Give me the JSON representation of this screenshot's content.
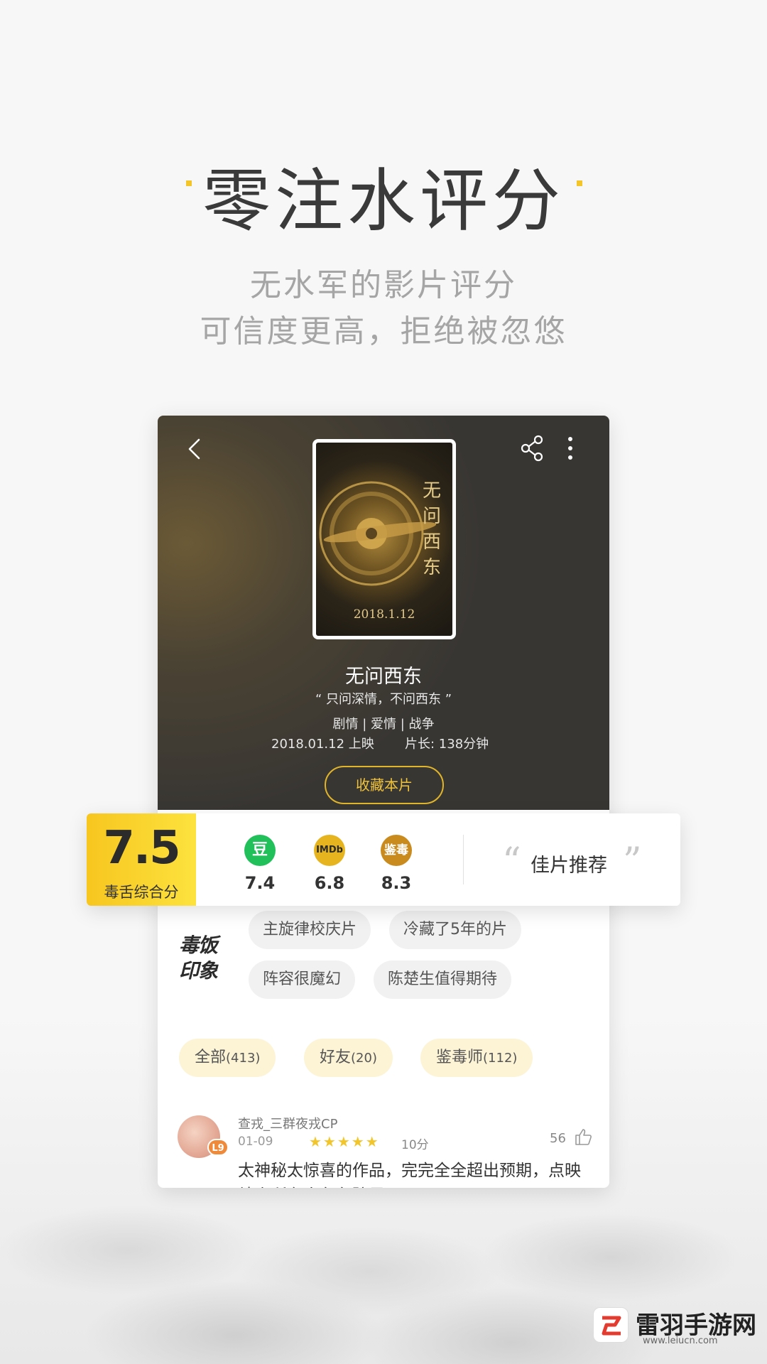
{
  "headline": "零注水评分",
  "subtitle_line1": "无水军的影片评分",
  "subtitle_line2": "可信度更高，拒绝被忽悠",
  "colors": {
    "accent": "#f7c61f",
    "douban": "#22c05a",
    "imdb": "#e5b41f",
    "jiandu": "#c98a1e"
  },
  "movie": {
    "poster": {
      "title_vertical": "无问西东",
      "date": "2018.1.12"
    },
    "title": "无问西东",
    "tagline": "“ 只问深情，不问西东 ”",
    "genres": "剧情 | 爱情 | 战争",
    "release": "2018.01.12 上映",
    "length": "片长: 138分钟",
    "collect_button": "收藏本片"
  },
  "rating": {
    "score": "7.5",
    "score_label": "毒舌综合分",
    "sources": [
      {
        "icon_text": "豆",
        "icon": "douban-icon",
        "value": "7.4"
      },
      {
        "icon_text": "IMDb",
        "icon": "imdb-icon",
        "value": "6.8"
      },
      {
        "icon_text": "鉴毒",
        "icon": "jiandu-icon",
        "value": "8.3"
      }
    ],
    "recommend": "佳片推荐"
  },
  "impression": {
    "logo_line1": "毒饭",
    "logo_line2": "印象",
    "tags": [
      "主旋律校庆片",
      "冷藏了5年的片",
      "阵容很魔幻",
      "陈楚生值得期待"
    ]
  },
  "filters": [
    {
      "label": "全部",
      "count": "(413)"
    },
    {
      "label": "好友",
      "count": "(20)"
    },
    {
      "label": "鉴毒师",
      "count": "(112)"
    }
  ],
  "comment": {
    "user": "查戎_三群夜戎CP",
    "level": "L9",
    "date": "01-09",
    "stars": "★★★★★",
    "score": "10分",
    "likes": "56",
    "text": "太神秘太惊喜的作品，完完全全超出预期，点映结束所有人久久驻足"
  },
  "watermark": {
    "name": "雷羽手游网",
    "url": "www.leiucn.com"
  }
}
